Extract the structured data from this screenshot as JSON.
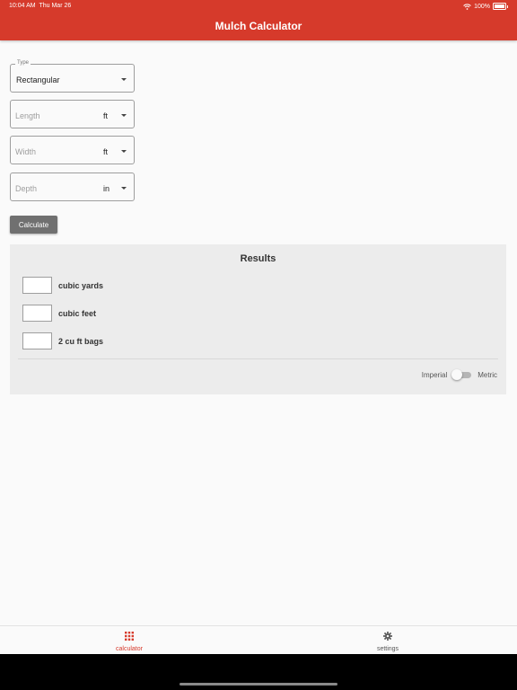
{
  "status_bar": {
    "time": "10:04 AM",
    "date": "Thu Mar 26",
    "battery": "100%"
  },
  "app": {
    "title": "Mulch Calculator"
  },
  "form": {
    "type": {
      "label": "Type",
      "value": "Rectangular"
    },
    "length": {
      "placeholder": "Length",
      "unit": "ft"
    },
    "width": {
      "placeholder": "Width",
      "unit": "ft"
    },
    "depth": {
      "placeholder": "Depth",
      "unit": "in"
    },
    "calculate_label": "Calculate"
  },
  "results": {
    "title": "Results",
    "rows": [
      {
        "value": "",
        "label": "cubic yards"
      },
      {
        "value": "",
        "label": "cubic feet"
      },
      {
        "value": "",
        "label": "2 cu ft bags"
      }
    ],
    "toggle": {
      "left_label": "Imperial",
      "right_label": "Metric",
      "metric_on": false
    }
  },
  "bottom_nav": {
    "items": [
      {
        "label": "calculator",
        "icon": "grid-icon",
        "active": true
      },
      {
        "label": "settings",
        "icon": "gear-icon",
        "active": false
      }
    ]
  },
  "colors": {
    "accent": "#d63a2b",
    "button": "#707070",
    "panel": "#ececec"
  }
}
